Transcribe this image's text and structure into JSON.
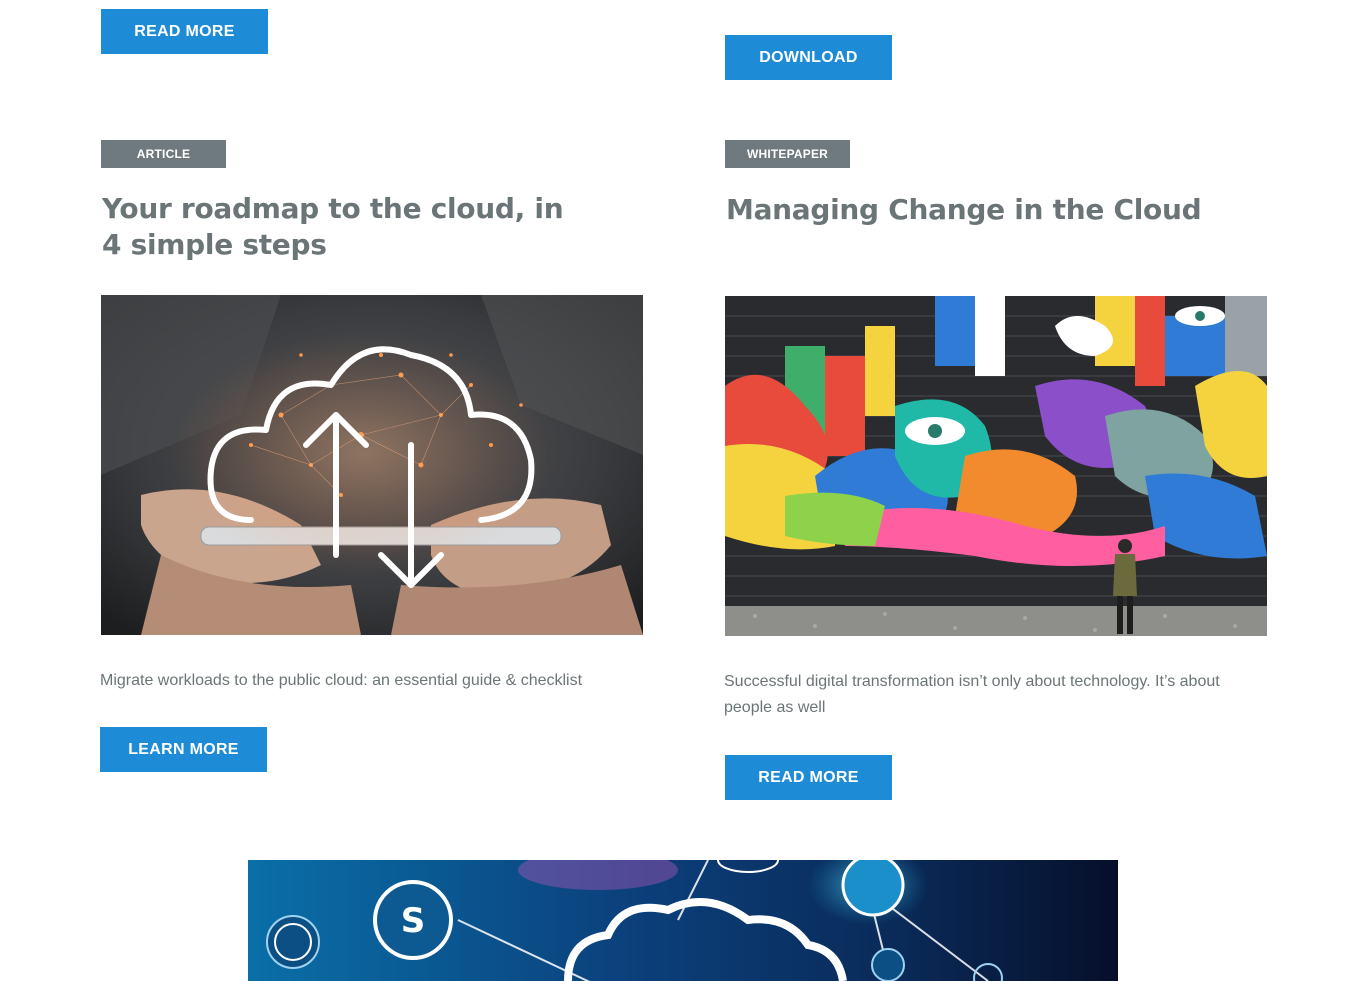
{
  "top": {
    "left_button": "READ MORE",
    "right_button": "DOWNLOAD"
  },
  "cards": [
    {
      "tag": "ARTICLE",
      "title": "Your roadmap to the cloud, in 4 simple steps",
      "image": "cloud-upload-download-hands-icon",
      "description": "Migrate workloads to the public cloud: an essential guide & checklist",
      "button": "LEARN MORE"
    },
    {
      "tag": "WHITEPAPER",
      "title": "Managing Change in the Cloud",
      "image": "colorful-mural-wall-photo",
      "description": "Successful digital transformation isn’t only about technology. It’s about people as well",
      "button": "READ MORE"
    }
  ],
  "banner": {
    "image": "cloud-network-security-banner"
  },
  "colors": {
    "button": "#1e8bd6",
    "tag": "#6e7a7d",
    "title": "#6b7577"
  }
}
